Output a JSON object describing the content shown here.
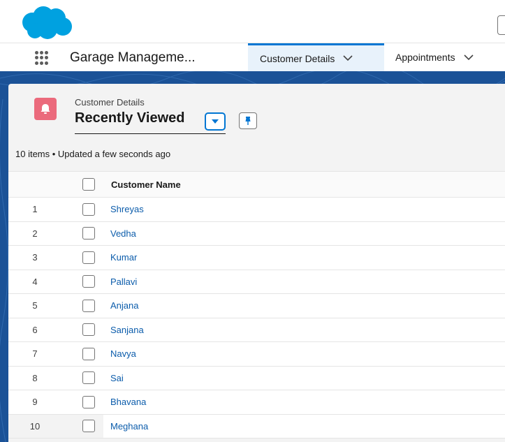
{
  "colors": {
    "brand_blue": "#00a1e0",
    "accent": "#0176d3",
    "object_icon": "#eb6a7c",
    "link": "#0b5cab",
    "background_band": "#1b5297"
  },
  "header": {
    "logo_icon": "cloud-logo-icon"
  },
  "nav": {
    "app_launcher_icon": "waffle-icon",
    "app_name": "Garage Manageme...",
    "tabs": [
      {
        "label": "Customer Details",
        "active": true,
        "icon": "chevron-down-icon"
      },
      {
        "label": "Appointments",
        "active": false,
        "icon": "chevron-down-icon"
      }
    ]
  },
  "list_view": {
    "object_icon": "object-icon",
    "object_label": "Customer Details",
    "title": "Recently Viewed",
    "dropdown_icon": "caret-down-icon",
    "pin_icon": "pin-icon",
    "status": "10 items • Updated a few seconds ago"
  },
  "table": {
    "columns": [
      "Customer Name"
    ],
    "rows": [
      {
        "num": "1",
        "name": "Shreyas"
      },
      {
        "num": "2",
        "name": "Vedha"
      },
      {
        "num": "3",
        "name": "Kumar"
      },
      {
        "num": "4",
        "name": "Pallavi"
      },
      {
        "num": "5",
        "name": "Anjana"
      },
      {
        "num": "6",
        "name": "Sanjana"
      },
      {
        "num": "7",
        "name": "Navya"
      },
      {
        "num": "8",
        "name": "Sai"
      },
      {
        "num": "9",
        "name": "Bhavana"
      },
      {
        "num": "10",
        "name": "Meghana"
      }
    ]
  }
}
